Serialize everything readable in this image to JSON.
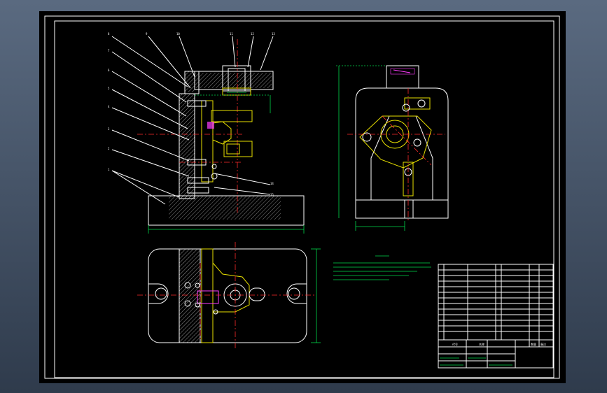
{
  "drawing": {
    "colors": {
      "background": "#000000",
      "outline": "#ffffff",
      "centerline": "#ff2b2b",
      "dimension": "#00d84a",
      "part": "#e8e000",
      "hole": "#ff3cff"
    },
    "views": [
      "front-section-view",
      "side-view",
      "top-view"
    ]
  },
  "title_block": {
    "label_code": "代号",
    "label_name": "名称",
    "label_qty": "数量",
    "label_note": "备注"
  }
}
